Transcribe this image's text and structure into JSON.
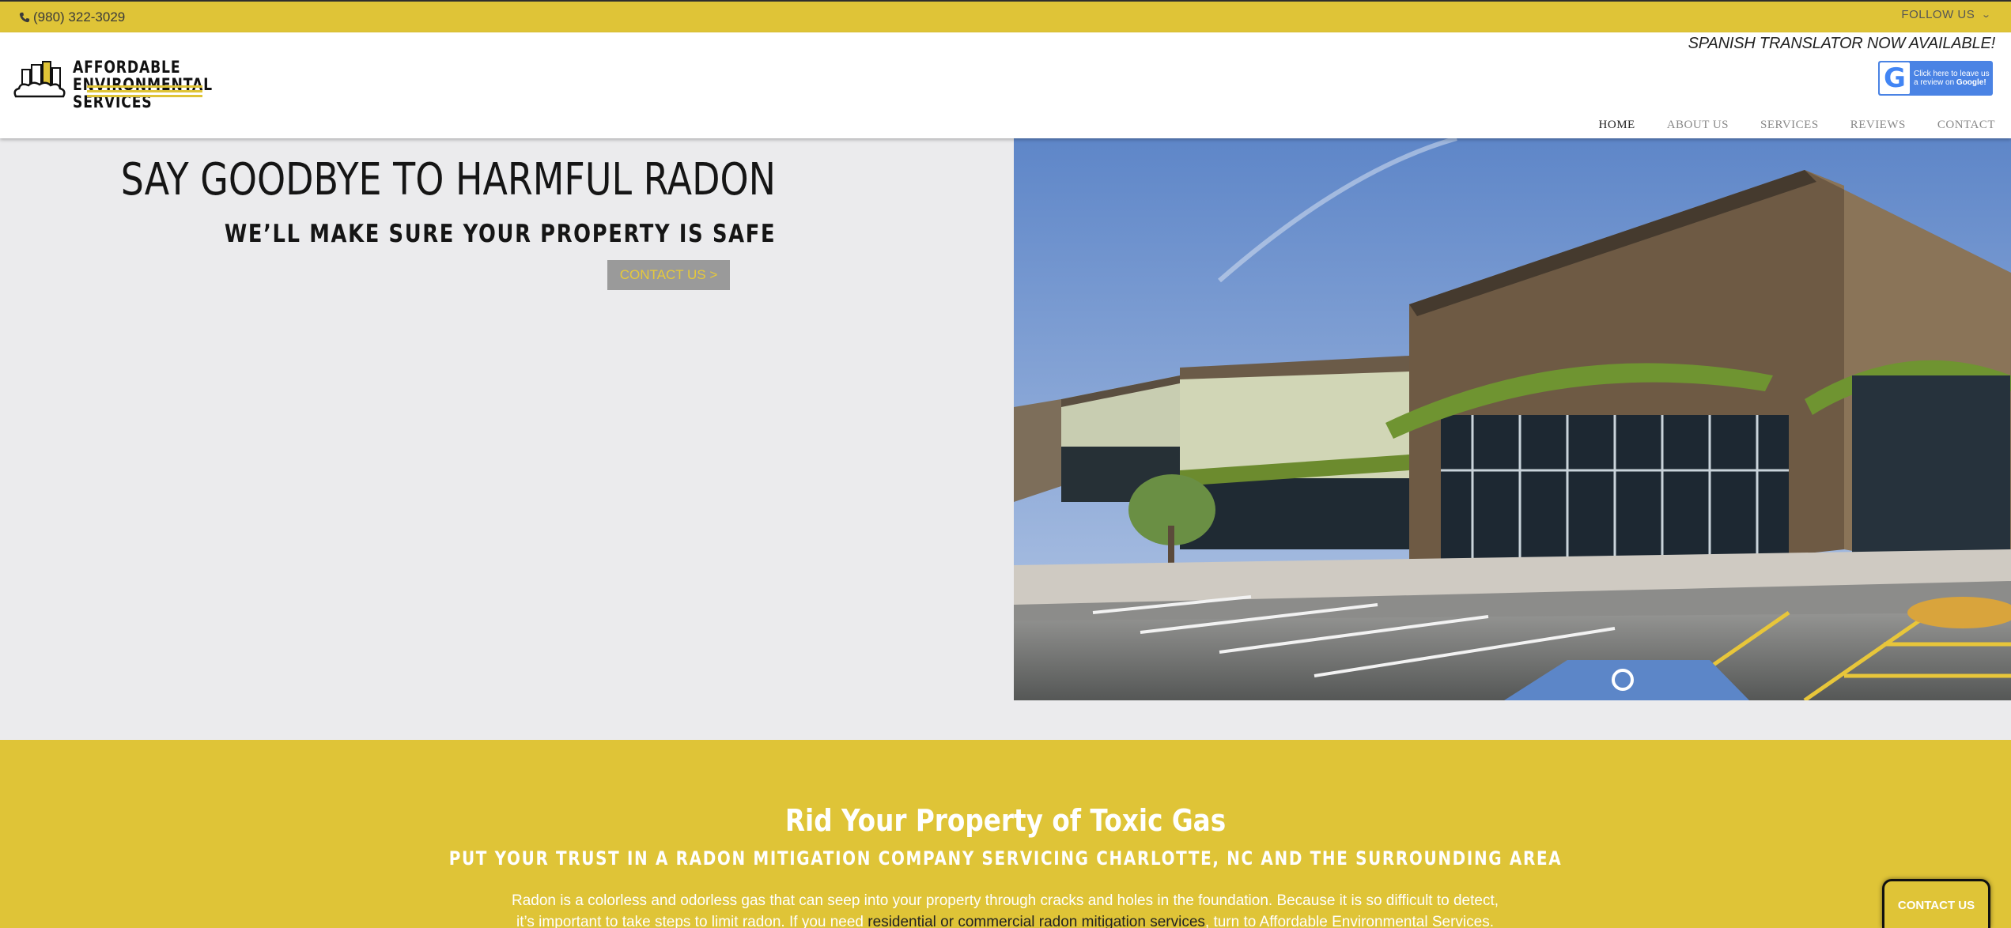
{
  "topbar": {
    "phone": "(980) 322-3029",
    "follow_label": "FOLLOW US",
    "follow_icon": "chevron-down-icon"
  },
  "header": {
    "logo_lines": [
      "AFFORDABLE",
      "ENVIRONMENTAL",
      "SERVICES"
    ],
    "translator_notice": "SPANISH TRANSLATOR NOW AVAILABLE!",
    "review_badge": {
      "line1": "Click here to leave us",
      "line2": "a review on",
      "brand": "Google!",
      "letter": "G"
    },
    "nav": [
      {
        "label": "HOME",
        "active": true
      },
      {
        "label": "ABOUT US",
        "active": false
      },
      {
        "label": "SERVICES",
        "active": false
      },
      {
        "label": "REVIEWS",
        "active": false
      },
      {
        "label": "CONTACT",
        "active": false
      }
    ]
  },
  "hero": {
    "title": "SAY GOODBYE TO HARMFUL RADON",
    "subtitle": "WE’LL MAKE SURE YOUR PROPERTY IS SAFE",
    "button_label": "CONTACT US >"
  },
  "about": {
    "title": "Rid Your Property of Toxic Gas",
    "subtitle": "PUT YOUR TRUST IN A RADON MITIGATION COMPANY SERVICING CHARLOTTE, NC AND THE SURROUNDING AREA",
    "body_part1": "Radon is a colorless and odorless gas that can seep into your property through cracks and holes in the foundation. Because it is so difficult to detect, it’s important to take steps to limit radon. If you need",
    "body_link": "residential or commercial radon mitigation services",
    "body_part2": ", turn to Affordable Environmental Services."
  },
  "floating_contact": {
    "label": "CONTACT US"
  },
  "colors": {
    "brand_yellow": "#dfc437",
    "hero_bg": "#ebebed",
    "button_gray": "#9a9a9a"
  }
}
